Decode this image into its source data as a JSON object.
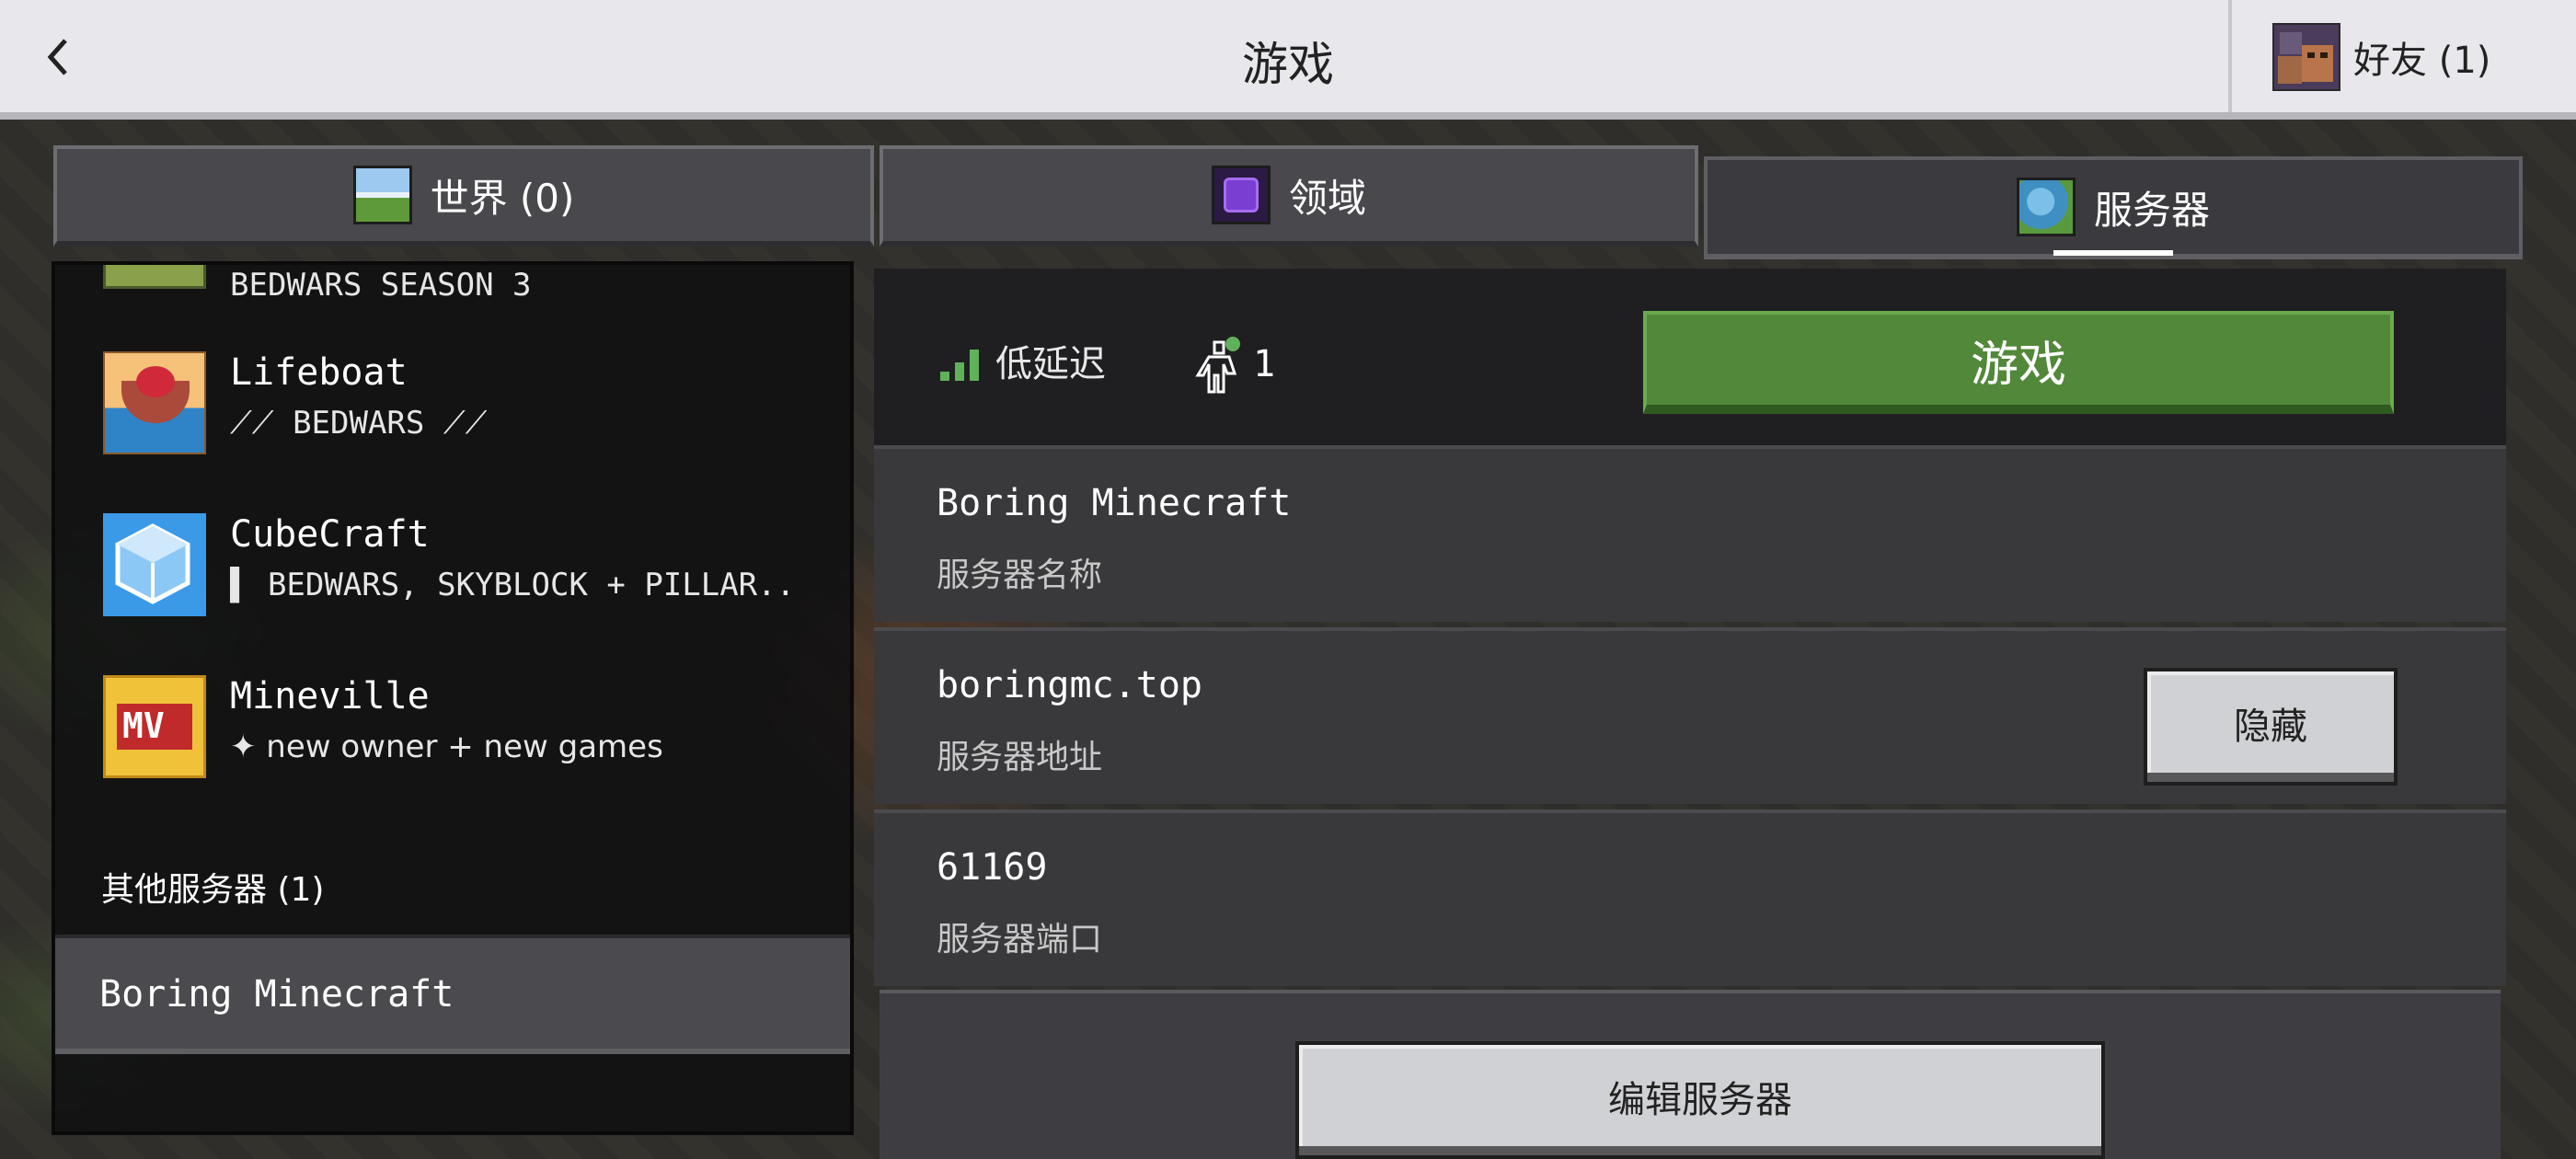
{
  "header": {
    "title": "游戏",
    "friends_label": "好友 (1)"
  },
  "tabs": [
    {
      "label": "世界 (0)",
      "icon": "world-icon"
    },
    {
      "label": "领域",
      "icon": "realms-icon"
    },
    {
      "label": "服务器",
      "icon": "server-globe-icon",
      "active": true
    }
  ],
  "servers": [
    {
      "name": "",
      "motd": "BEDWARS SEASON 3",
      "icon": "hive-icon"
    },
    {
      "name": "Lifeboat",
      "motd": "⟋⟋ BEDWARS ⟋⟋",
      "icon": "lifeboat-icon"
    },
    {
      "name": "CubeCraft",
      "motd": "▌ BEDWARS, SKYBLOCK + PILLAR..",
      "icon": "cubecraft-icon"
    },
    {
      "name": "Mineville",
      "motd": "✦ new owner + new games",
      "icon": "mineville-icon"
    }
  ],
  "other_servers": {
    "label": "其他服务器 (1)",
    "items": [
      {
        "name": "Boring Minecraft"
      }
    ]
  },
  "details": {
    "latency_label": "低延迟",
    "player_count": "1",
    "play_label": "游戏",
    "server_name": "Boring Minecraft",
    "server_name_label": "服务器名称",
    "address": "boringmc.top",
    "address_label": "服务器地址",
    "hide_label": "隐藏",
    "port": "61169",
    "port_label": "服务器端口",
    "edit_label": "编辑服务器"
  },
  "colors": {
    "play_button": "#52883a",
    "latency_good": "#5fb25a",
    "header_bg": "#e8e8ec"
  }
}
